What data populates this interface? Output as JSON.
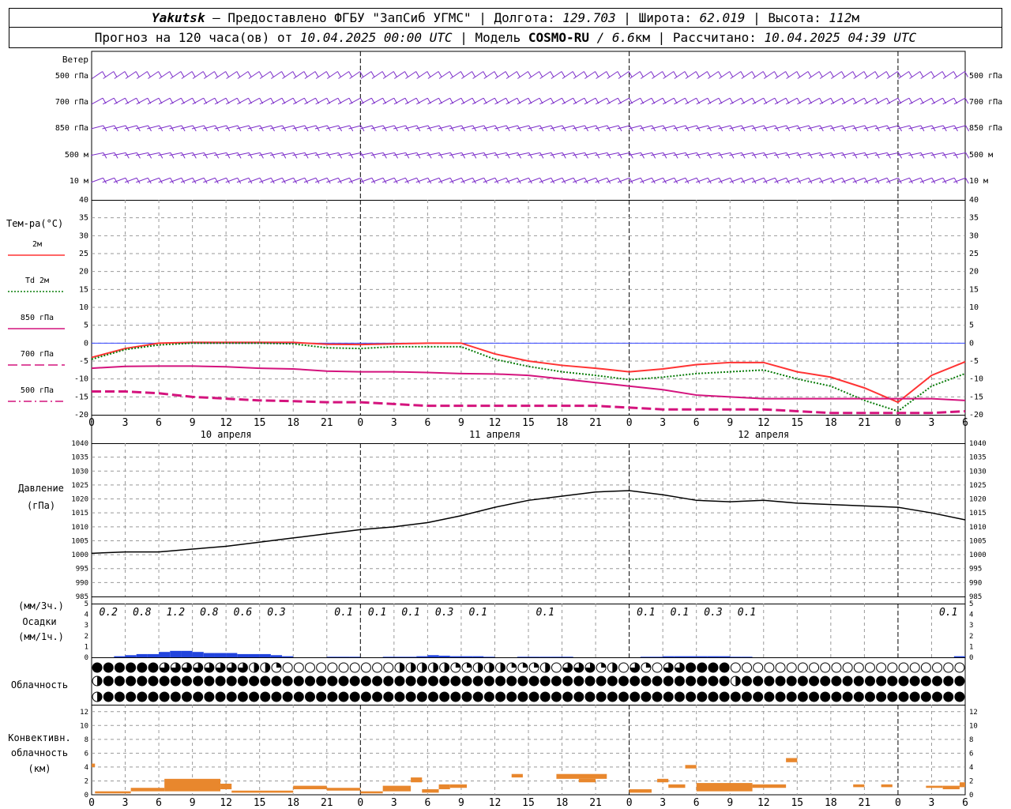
{
  "header": {
    "station": "Yakutsk",
    "provider": "Предоставлено ФГБУ \"ЗапСиб УГМС\"",
    "lon_label": "Долгота:",
    "lon_value": "129.703",
    "lat_label": "Широта:",
    "lat_value": "62.019",
    "alt_label": "Высота:",
    "alt_value": "112",
    "alt_unit": "м",
    "forecast_label": "Прогноз на 120 часа(ов) от",
    "forecast_from": "10.04.2025 00:00 UTC",
    "model_label": "| Модель",
    "model_name": "COSMO-RU",
    "model_res": " / 6.6",
    "model_res_unit": "км",
    "calc_label": "| Рассчитано:",
    "calc_time": "10.04.2025 04:39 UTC"
  },
  "wind_panel": {
    "title": "Ветер",
    "levels": [
      "500 гПа",
      "700 гПа",
      "850 гПа",
      "500 м",
      "10  м"
    ],
    "color": "#7b2cc9"
  },
  "time_axis": {
    "ticks": [
      "0",
      "3",
      "6",
      "9",
      "12",
      "15",
      "18",
      "21",
      "0",
      "3",
      "6",
      "9",
      "12",
      "15",
      "18",
      "21",
      "0",
      "3",
      "6",
      "9",
      "12",
      "15",
      "18",
      "21",
      "0",
      "3",
      "6"
    ],
    "day_labels": [
      "10 апреля",
      "11 апреля",
      "12 апреля"
    ]
  },
  "chart_data": [
    {
      "type": "line",
      "name": "temperature",
      "title": "Тем-ра(°C)",
      "ylim": [
        -20,
        40
      ],
      "yticks": [
        "40",
        "35",
        "30",
        "25",
        "20",
        "15",
        "10",
        "5",
        "0",
        "-5",
        "-10",
        "-15",
        "-20"
      ],
      "x_hours": [
        0,
        3,
        6,
        9,
        12,
        15,
        18,
        21,
        24,
        27,
        30,
        33,
        36,
        39,
        42,
        45,
        48,
        51,
        54,
        57,
        60,
        63,
        66,
        69,
        72,
        75,
        78
      ],
      "series": [
        {
          "name": "2м",
          "color": "#ff3333",
          "values": [
            -4,
            -1.5,
            0,
            0.2,
            0.2,
            0.2,
            0.2,
            -0.3,
            -0.4,
            -0.2,
            0,
            0,
            -3,
            -5,
            -6.2,
            -7,
            -8,
            -7.2,
            -6,
            -5.4,
            -5.4,
            -8,
            -9.5,
            -12.5,
            -16.5,
            -9,
            -5.2
          ]
        },
        {
          "name": "Td 2м",
          "color": "#0a7d0a",
          "values": [
            -4.5,
            -1.8,
            -0.5,
            0,
            0,
            0,
            -0.2,
            -1.3,
            -1.5,
            -1,
            -1,
            -1,
            -4.5,
            -6.5,
            -8,
            -9,
            -10.2,
            -9.5,
            -8.5,
            -8,
            -7.5,
            -10,
            -12,
            -16,
            -19,
            -12,
            -8.5
          ]
        },
        {
          "name": "850 гПа",
          "color": "#d4137d",
          "values": [
            -7,
            -6.5,
            -6.4,
            -6.4,
            -6.6,
            -7,
            -7.2,
            -7.8,
            -8,
            -8,
            -8.2,
            -8.5,
            -8.6,
            -9,
            -10,
            -11,
            -12,
            -13,
            -14.5,
            -15,
            -15.5,
            -15.5,
            -15.5,
            -15.5,
            -15.5,
            -15.5,
            -16
          ]
        },
        {
          "name": "700 гПа",
          "color": "#d4137d",
          "values": [
            -13.5,
            -13.5,
            -14,
            -15,
            -15.5,
            -16,
            -16.2,
            -16.5,
            -16.5,
            -17,
            -17.5,
            -17.5,
            -17.5,
            -17.5,
            -17.5,
            -17.5,
            -18,
            -18.5,
            -18.5,
            -18.5,
            -18.5,
            -19,
            -19.5,
            -19.5,
            -19.5,
            -19.5,
            -19
          ]
        },
        {
          "name": "500 гПа",
          "color": "#d4137d",
          "values": []
        }
      ]
    },
    {
      "type": "line",
      "name": "pressure",
      "title": "Давление",
      "ylabel": "(гПа)",
      "ylim": [
        985,
        1040
      ],
      "yticks": [
        "1040",
        "1035",
        "1030",
        "1025",
        "1020",
        "1015",
        "1010",
        "1005",
        "1000",
        "995",
        "990",
        "985"
      ],
      "x_hours": [
        0,
        3,
        6,
        9,
        12,
        15,
        18,
        21,
        24,
        27,
        30,
        33,
        36,
        39,
        42,
        45,
        48,
        51,
        54,
        57,
        60,
        63,
        66,
        69,
        72,
        75,
        78
      ],
      "series": [
        {
          "name": "P",
          "color": "#000000",
          "values": [
            1000.5,
            1001,
            1001,
            1002,
            1003,
            1004.5,
            1006,
            1007.5,
            1009,
            1010,
            1011.5,
            1014,
            1017,
            1019.5,
            1021,
            1022.5,
            1023,
            1021.5,
            1019.5,
            1019,
            1019.5,
            1018.5,
            1018,
            1017.5,
            1017,
            1015,
            1012.5
          ]
        }
      ]
    },
    {
      "type": "bar",
      "name": "precipitation",
      "title": "Осадки",
      "ylabel_top": "(мм/3ч.)",
      "ylabel_bottom": "(мм/1ч.)",
      "ylim": [
        0,
        5
      ],
      "yticks": [
        "5",
        "4",
        "3",
        "2",
        "1",
        "0"
      ],
      "totals_3h": [
        {
          "hour": 1.5,
          "label": "0.2"
        },
        {
          "hour": 4.5,
          "label": "0.8"
        },
        {
          "hour": 7.5,
          "label": "1.2"
        },
        {
          "hour": 10.5,
          "label": "0.8"
        },
        {
          "hour": 13.5,
          "label": "0.6"
        },
        {
          "hour": 16.5,
          "label": "0.3"
        },
        {
          "hour": 22.5,
          "label": "0.1"
        },
        {
          "hour": 25.5,
          "label": "0.1"
        },
        {
          "hour": 28.5,
          "label": "0.1"
        },
        {
          "hour": 31.5,
          "label": "0.3"
        },
        {
          "hour": 34.5,
          "label": "0.1"
        },
        {
          "hour": 40.5,
          "label": "0.1"
        },
        {
          "hour": 49.5,
          "label": "0.1"
        },
        {
          "hour": 52.5,
          "label": "0.1"
        },
        {
          "hour": 55.5,
          "label": "0.3"
        },
        {
          "hour": 58.5,
          "label": "0.1"
        },
        {
          "hour": 76.5,
          "label": "0.1"
        }
      ],
      "hourly": [
        0,
        0,
        0.1,
        0.2,
        0.3,
        0.3,
        0.5,
        0.6,
        0.6,
        0.5,
        0.4,
        0.4,
        0.4,
        0.3,
        0.3,
        0.3,
        0.2,
        0.1,
        0,
        0,
        0,
        0.05,
        0.05,
        0.05,
        0,
        0,
        0.05,
        0.05,
        0.05,
        0.1,
        0.2,
        0.15,
        0.1,
        0.1,
        0.1,
        0.05,
        0,
        0,
        0.05,
        0.05,
        0.05,
        0.05,
        0.05,
        0,
        0,
        0,
        0,
        0,
        0,
        0.05,
        0.05,
        0.1,
        0.1,
        0.1,
        0.1,
        0.1,
        0.1,
        0.05,
        0.05,
        0,
        0,
        0,
        0,
        0,
        0,
        0,
        0,
        0,
        0,
        0,
        0,
        0,
        0,
        0,
        0,
        0,
        0,
        0.1
      ]
    },
    {
      "type": "bar",
      "name": "convective_clouds",
      "title": "Конвективн. облачность",
      "ylabel": "(км)",
      "ylim": [
        0,
        13
      ],
      "yticks": [
        "12",
        "10",
        "8",
        "6",
        "4",
        "2",
        "0"
      ],
      "layers": [
        {
          "x0": 0,
          "x1": 0.3,
          "base": 4,
          "top": 4.5
        },
        {
          "x0": 0.3,
          "x1": 3.5,
          "base": 0.2,
          "top": 0.5
        },
        {
          "x0": 3.5,
          "x1": 6.5,
          "base": 0.5,
          "top": 1
        },
        {
          "x0": 6.5,
          "x1": 11.5,
          "base": 0.5,
          "top": 2.3
        },
        {
          "x0": 11.5,
          "x1": 12.5,
          "base": 0.8,
          "top": 1.6
        },
        {
          "x0": 12.5,
          "x1": 18,
          "base": 0.3,
          "top": 0.6
        },
        {
          "x0": 18,
          "x1": 21,
          "base": 0.8,
          "top": 1.3
        },
        {
          "x0": 21,
          "x1": 24,
          "base": 0.6,
          "top": 1
        },
        {
          "x0": 24,
          "x1": 26,
          "base": 0.2,
          "top": 0.5
        },
        {
          "x0": 26,
          "x1": 28.5,
          "base": 0.5,
          "top": 1.3
        },
        {
          "x0": 28.5,
          "x1": 29.5,
          "base": 1.8,
          "top": 2.5
        },
        {
          "x0": 29.5,
          "x1": 31,
          "base": 0.3,
          "top": 0.8
        },
        {
          "x0": 31,
          "x1": 32,
          "base": 0.8,
          "top": 1.5
        },
        {
          "x0": 32,
          "x1": 33.5,
          "base": 1,
          "top": 1.5
        },
        {
          "x0": 37.5,
          "x1": 38.5,
          "base": 2.5,
          "top": 3
        },
        {
          "x0": 41.5,
          "x1": 46,
          "base": 2.3,
          "top": 3
        },
        {
          "x0": 43.5,
          "x1": 45,
          "base": 1.8,
          "top": 2.3
        },
        {
          "x0": 48,
          "x1": 50,
          "base": 0.3,
          "top": 0.8
        },
        {
          "x0": 50.5,
          "x1": 51.5,
          "base": 1.8,
          "top": 2.3
        },
        {
          "x0": 51.5,
          "x1": 53,
          "base": 1,
          "top": 1.5
        },
        {
          "x0": 53,
          "x1": 54,
          "base": 3.8,
          "top": 4.3
        },
        {
          "x0": 54,
          "x1": 59,
          "base": 0.5,
          "top": 1.7
        },
        {
          "x0": 59,
          "x1": 62,
          "base": 1,
          "top": 1.5
        },
        {
          "x0": 62,
          "x1": 63,
          "base": 4.7,
          "top": 5.3
        },
        {
          "x0": 68,
          "x1": 69,
          "base": 1.1,
          "top": 1.5
        },
        {
          "x0": 70.5,
          "x1": 71.5,
          "base": 1.1,
          "top": 1.5
        },
        {
          "x0": 74.5,
          "x1": 76,
          "base": 1,
          "top": 1.3
        },
        {
          "x0": 76,
          "x1": 77.5,
          "base": 0.8,
          "top": 1.3
        },
        {
          "x0": 77.5,
          "x1": 78,
          "base": 1.1,
          "top": 1.8
        }
      ]
    }
  ],
  "cloud_panel": {
    "title": "Облачность",
    "rows": [
      "ffffffeeeeeeeeccbaaaaaaaaaacccccbbcccdddcaeeedcaedaeeffffaaaaaaaaaaaaaaaaaaaaaaaaaaaaaaaaaaaaaaaaaaaaaaaaaaaaaad",
      "cffffffffffffffffffffffffffffffffffffffffffffffffffffffffcffffffffffffffffffffffffffffffffffffcaaacaaacaaaaaaaaaaaaaaaaaaaaaaa",
      "cffffffffffffffffffffffffffffffffffffffffffffffffffffffffffffffffffffffffffffffffffffffffffffffffffcfbaaaaaaaaaaaaaaaaaaffff"
    ]
  }
}
